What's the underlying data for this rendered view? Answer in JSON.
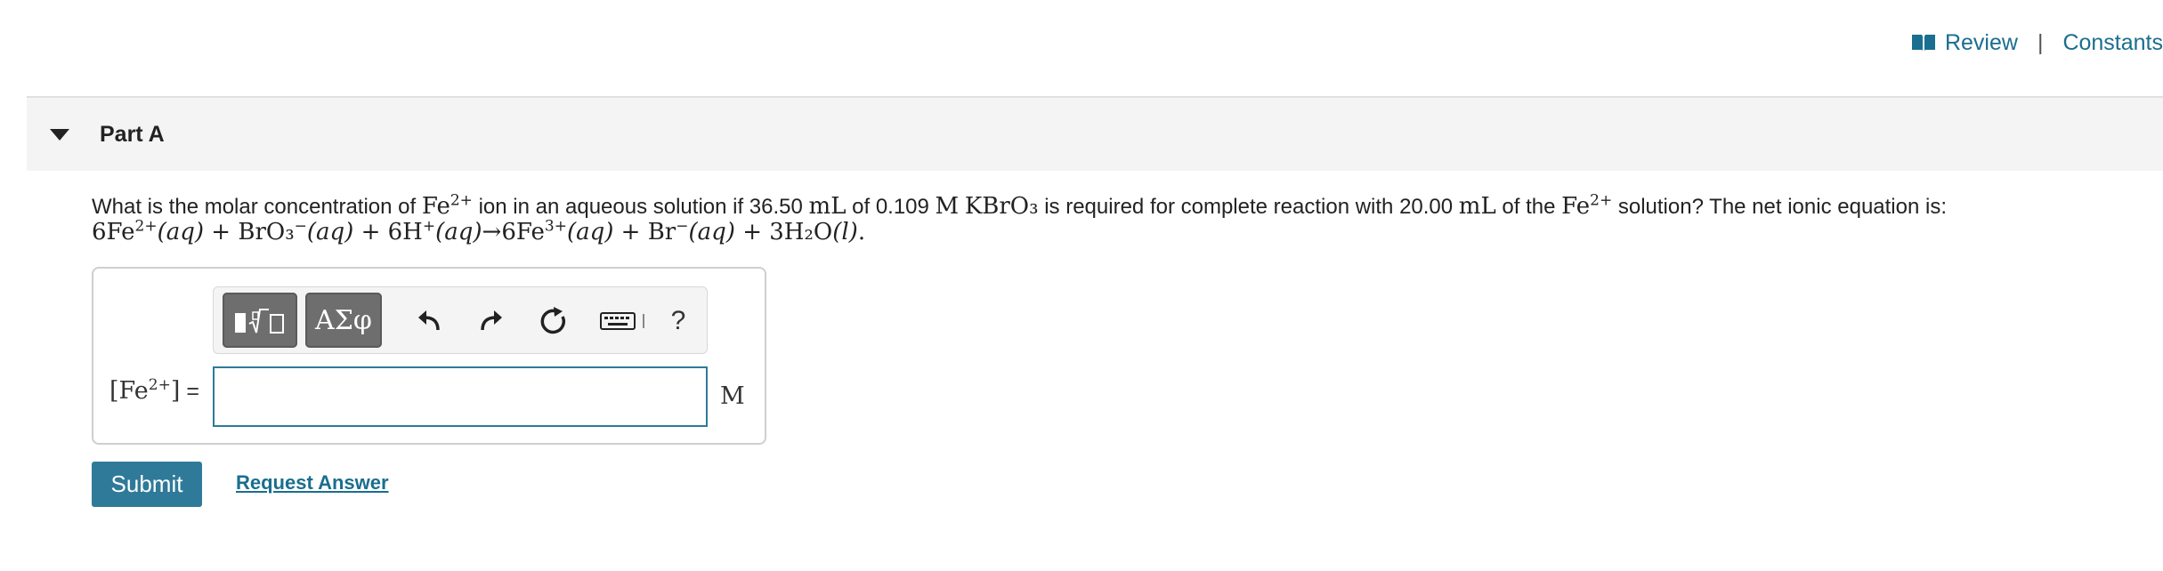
{
  "topbar": {
    "review_label": "Review",
    "separator": "|",
    "constants_label": "Constants"
  },
  "part": {
    "title": "Part A"
  },
  "question": {
    "q1": "What is the molar concentration of ",
    "ion_base": "Fe",
    "ion_charge": "2+",
    "q2": " ion in an aqueous solution if 36.50 ",
    "unit_ml": "mL",
    "q3": " of 0.109 ",
    "unit_m": "M",
    "compound": "KBrO₃",
    "q4": " is required for complete reaction with 20.00 ",
    "q5": " of the ",
    "q6": " solution? The net ionic equation is:",
    "equation_parts": [
      "6Fe",
      "2+",
      "(aq)",
      " + BrO₃",
      "−",
      "(aq)",
      " + 6H",
      "+",
      "(aq)",
      "→6Fe",
      "3+",
      "(aq)",
      " + Br",
      "−",
      "(aq)",
      " + 3H₂O",
      "(l)",
      "."
    ]
  },
  "answer": {
    "lhs_base": "[Fe",
    "lhs_charge": "2+",
    "lhs_close": "]",
    "equals": "=",
    "value": "",
    "unit": "M",
    "greek_label": "ΑΣφ",
    "help_label": "?"
  },
  "actions": {
    "submit_label": "Submit",
    "request_answer_label": "Request Answer"
  },
  "colors": {
    "accent": "#2f7a99",
    "link": "#1a6e8f"
  }
}
